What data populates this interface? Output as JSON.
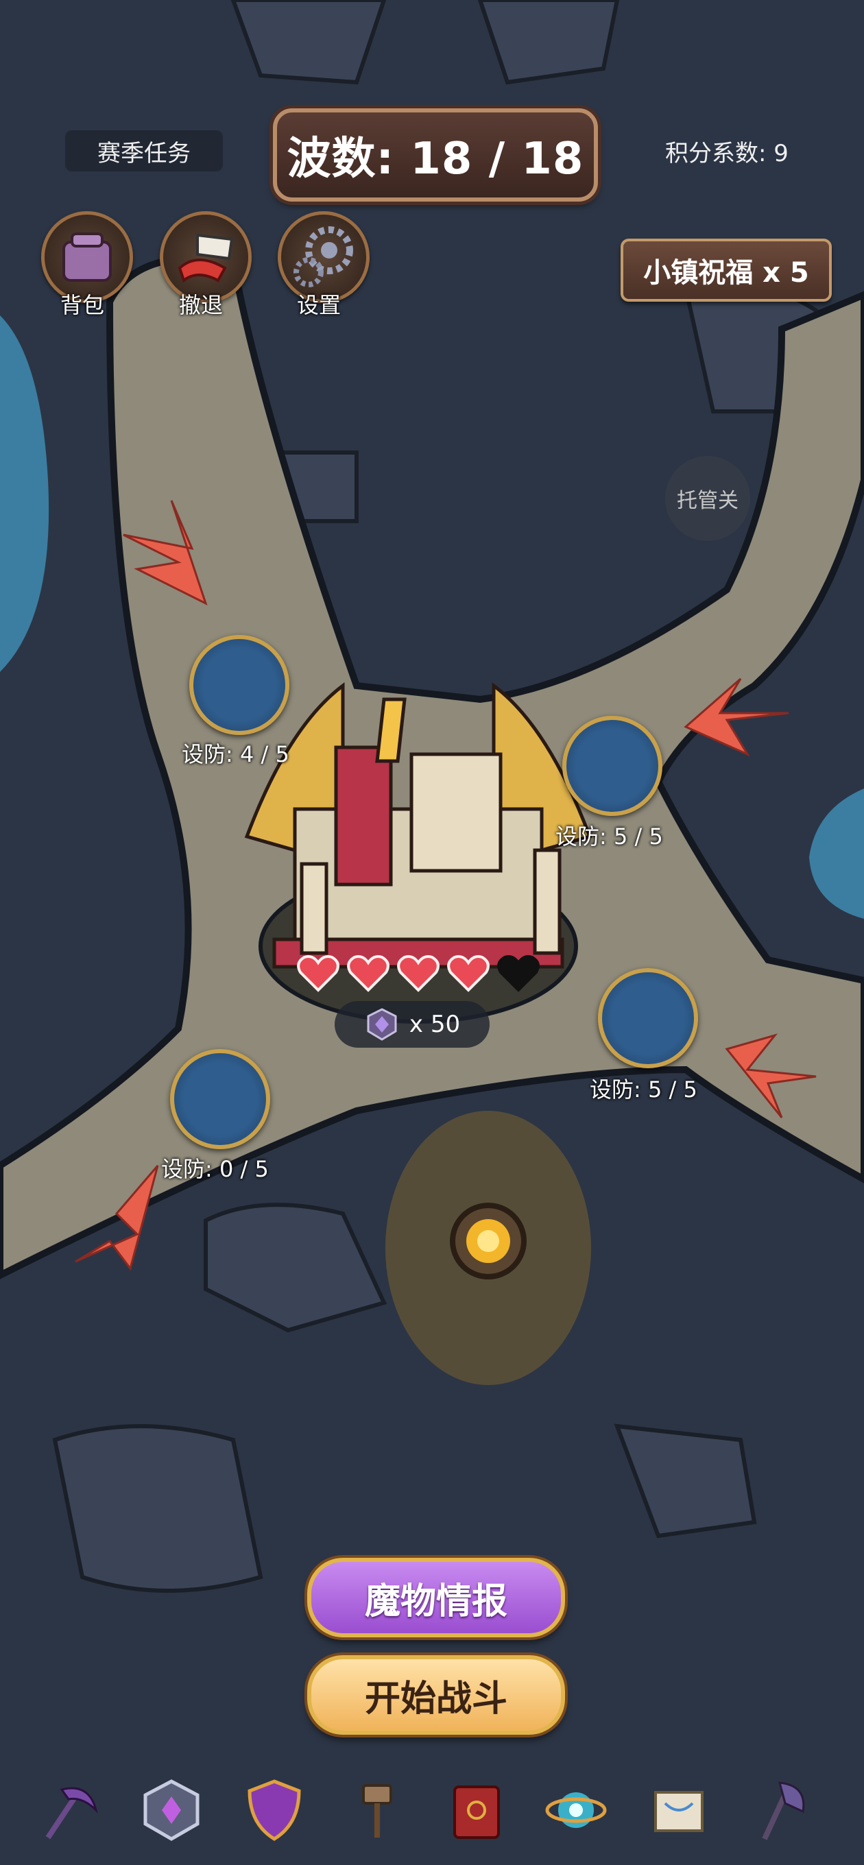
{
  "header": {
    "season_tasks": "赛季任务",
    "wave_text": "波数: 18 / 18",
    "score_factor": "积分系数: 9"
  },
  "top_actions": [
    {
      "label": "背包",
      "icon": "backpack-icon"
    },
    {
      "label": "撤退",
      "icon": "retreat-flag-icon"
    },
    {
      "label": "设置",
      "icon": "gears-icon"
    }
  ],
  "blessing": {
    "label": "小镇祝福 x 5"
  },
  "auto_battle": {
    "label": "托管关"
  },
  "towers": [
    {
      "label": "设防: 4 / 5",
      "built": 4,
      "max": 5
    },
    {
      "label": "设防: 5 / 5",
      "built": 5,
      "max": 5
    },
    {
      "label": "设防: 5 / 5",
      "built": 5,
      "max": 5
    },
    {
      "label": "设防: 0 / 5",
      "built": 0,
      "max": 5
    }
  ],
  "castle": {
    "hearts_total": 5,
    "hearts_filled": 4,
    "gem_count": "x 50",
    "heart_color": "#e94a55"
  },
  "buttons": {
    "monster_info": "魔物情报",
    "start_battle": "开始战斗"
  },
  "bottom_dock": [
    {
      "icon": "scythe-icon"
    },
    {
      "icon": "rank-badge-icon"
    },
    {
      "icon": "shield-icon"
    },
    {
      "icon": "hammer-icon"
    },
    {
      "icon": "spellbook-icon"
    },
    {
      "icon": "orb-icon"
    },
    {
      "icon": "scroll-map-icon"
    },
    {
      "icon": "axe-icon"
    }
  ],
  "colors": {
    "arrow": "#e8604c",
    "path": "#8f8a7a",
    "rock": "#2c3545",
    "water": "#3b7ea1"
  }
}
